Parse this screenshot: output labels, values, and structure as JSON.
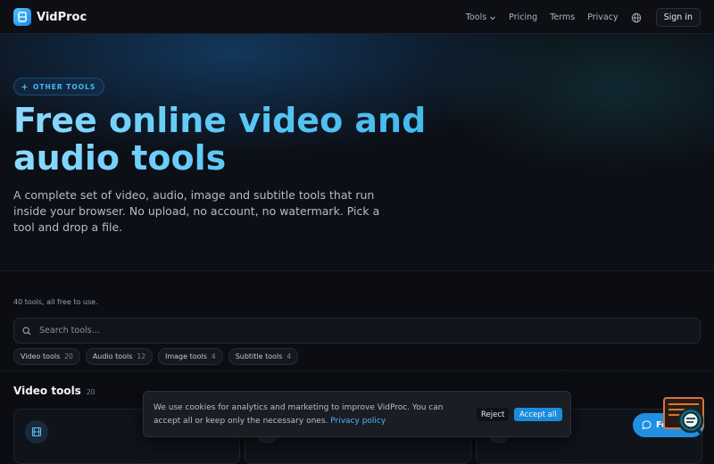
{
  "header": {
    "brand": "VidProc",
    "nav": [
      "Tools",
      "Pricing",
      "Terms",
      "Privacy"
    ],
    "sign_in": "Sign in"
  },
  "hero": {
    "badge": "OTHER TOOLS",
    "title": "Free online video and audio tools",
    "description": "A complete set of video, audio, image and subtitle tools that run inside your browser. No upload, no account, no watermark. Pick a tool and drop a file."
  },
  "tools": {
    "count_text": "40 tools, all free to use.",
    "search_placeholder": "Search tools...",
    "categories": [
      {
        "label": "Video tools",
        "count": "20"
      },
      {
        "label": "Audio tools",
        "count": "12"
      },
      {
        "label": "Image tools",
        "count": "4"
      },
      {
        "label": "Subtitle tools",
        "count": "4"
      }
    ],
    "section_title": "Video tools",
    "section_count": "20"
  },
  "cookie": {
    "text": "We use cookies for analytics and marketing to improve VidProc. You can accept all or keep only the necessary ones.",
    "link": "Privacy policy",
    "reject": "Reject",
    "accept": "Accept all"
  },
  "feedback": {
    "label": "Feedback"
  },
  "colors": {
    "accent": "#1f8fe2",
    "title_gradient_start": "#8fd9ff",
    "title_gradient_end": "#3fb5e8",
    "background": "#0b0d12"
  }
}
